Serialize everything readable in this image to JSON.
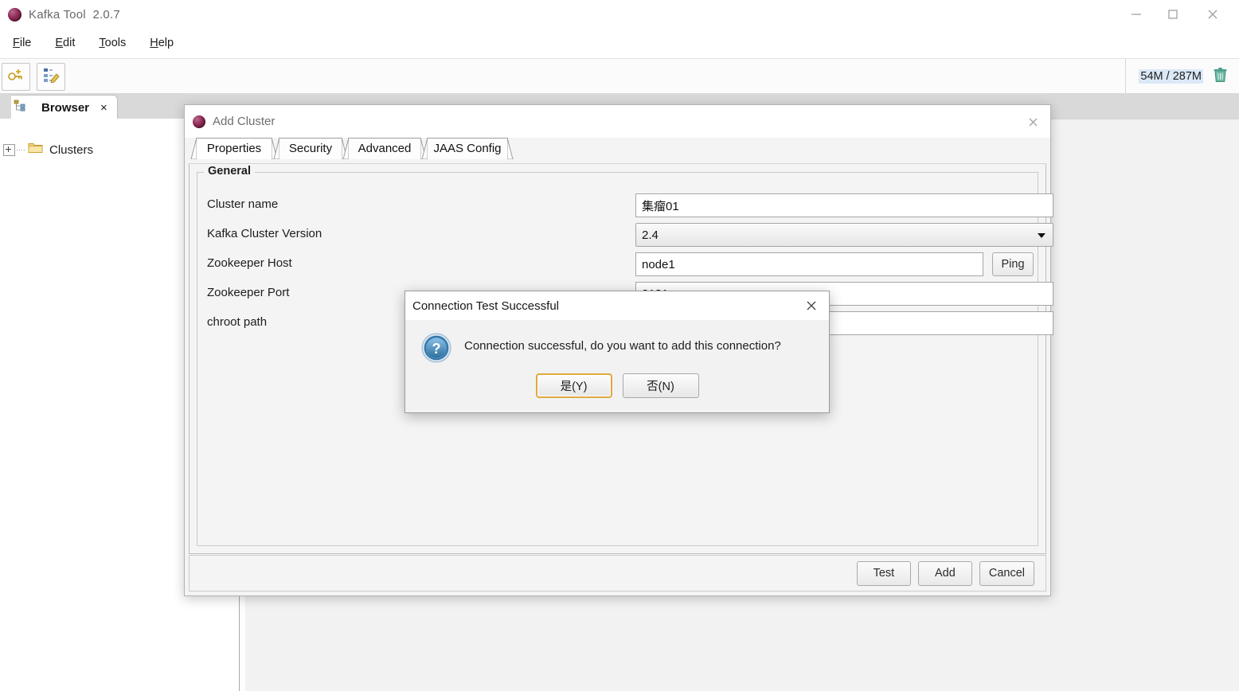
{
  "window": {
    "title": "Kafka Tool  2.0.7",
    "app_icon": "kafka-tool-icon",
    "controls": {
      "minimize": "minimize-icon",
      "maximize": "maximize-icon",
      "close": "close-icon"
    }
  },
  "menubar": {
    "items": [
      {
        "label": "File",
        "mnemonic": "F"
      },
      {
        "label": "Edit",
        "mnemonic": "E"
      },
      {
        "label": "Tools",
        "mnemonic": "T"
      },
      {
        "label": "Help",
        "mnemonic": "H"
      }
    ]
  },
  "toolbar": {
    "buttons": [
      {
        "name": "add-cluster-button",
        "icon": "key-add-icon"
      },
      {
        "name": "edit-cluster-button",
        "icon": "tree-edit-icon"
      }
    ],
    "memory_text": "54M / 287M",
    "trash_icon": "trash-icon"
  },
  "tabstrip": {
    "tabs": [
      {
        "label": "Browser",
        "icon": "browser-tree-icon",
        "close": "×",
        "selected": true
      }
    ]
  },
  "tree": {
    "root_label": "Clusters",
    "expander": "expand-plus-icon",
    "folder_icon": "folder-icon"
  },
  "dialog": {
    "title": "Add Cluster",
    "icon": "kafka-tool-icon",
    "close": "close-icon",
    "tabs": [
      {
        "label": "Properties",
        "selected": true
      },
      {
        "label": "Security",
        "selected": false
      },
      {
        "label": "Advanced",
        "selected": false
      },
      {
        "label": "JAAS Config",
        "selected": false
      }
    ],
    "group_title": "General",
    "fields": [
      {
        "label": "Cluster name",
        "value": "集瘤01",
        "type": "text"
      },
      {
        "label": "Kafka Cluster Version",
        "value": "2.4",
        "type": "combo"
      },
      {
        "label": "Zookeeper Host",
        "value": "node1",
        "type": "text",
        "button": "Ping"
      },
      {
        "label": "Zookeeper Port",
        "value": "2181",
        "type": "text"
      },
      {
        "label": "chroot path",
        "value": "",
        "type": "text"
      }
    ],
    "footer_buttons": [
      {
        "label": "Test",
        "name": "test-button"
      },
      {
        "label": "Add",
        "name": "add-button"
      },
      {
        "label": "Cancel",
        "name": "cancel-button"
      }
    ]
  },
  "messagebox": {
    "title": "Connection Test Successful",
    "close": "close-icon",
    "icon": "question-circle-icon",
    "message": "Connection successful, do you want to add this connection?",
    "buttons": [
      {
        "label": "是(Y)",
        "name": "yes-button",
        "default": true
      },
      {
        "label": "否(N)",
        "name": "no-button",
        "default": false
      }
    ]
  },
  "colors": {
    "accent_yellow": "#e0a93f",
    "tabstrip_bg": "#d9d9d9",
    "dialog_bg": "#f4f4f4",
    "memory_highlight": "#dbe8f7"
  }
}
